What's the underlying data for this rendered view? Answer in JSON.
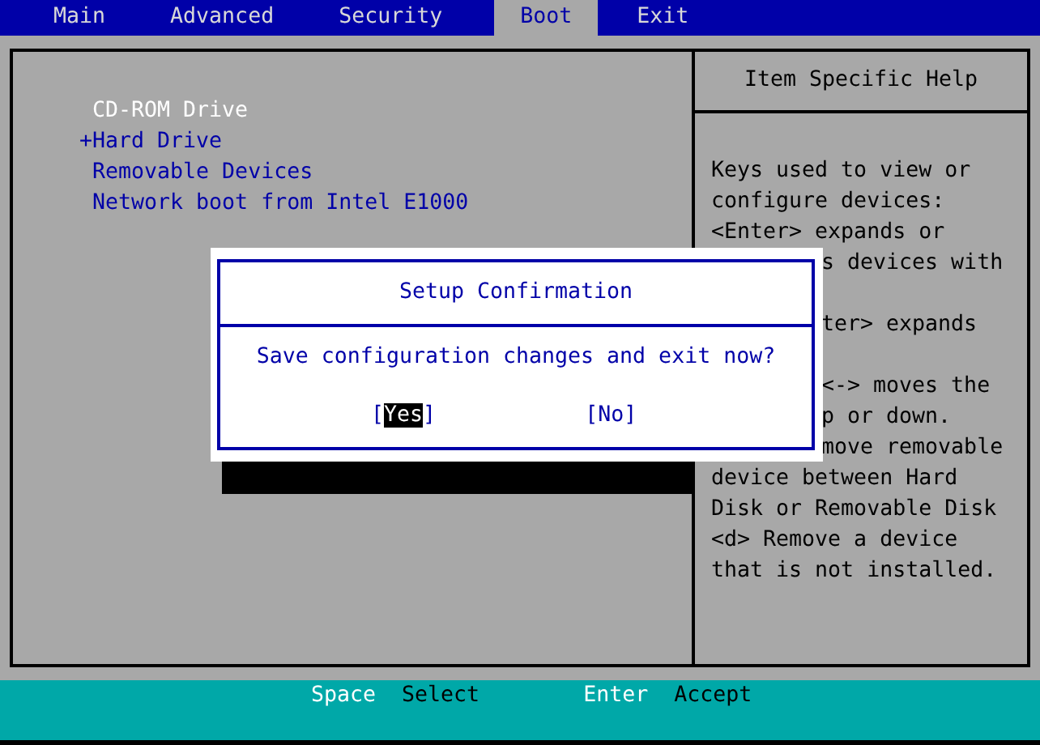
{
  "menu": [
    {
      "label": "Main",
      "selected": false
    },
    {
      "label": "Advanced",
      "selected": false
    },
    {
      "label": "Security",
      "selected": false
    },
    {
      "label": "Boot",
      "selected": true
    },
    {
      "label": "Exit",
      "selected": false
    }
  ],
  "boot_items": [
    {
      "label": "CD-ROM Drive",
      "kind": "device",
      "selected": true
    },
    {
      "label": "+Hard Drive",
      "kind": "expandable",
      "selected": false
    },
    {
      "label": "Removable Devices",
      "kind": "device",
      "selected": false
    },
    {
      "label": "Network boot from Intel E1000",
      "kind": "device",
      "selected": false
    }
  ],
  "help": {
    "title": "Item Specific Help",
    "lines": [
      {
        "text": "Keys used to view or",
        "kind": "full"
      },
      {
        "text": "configure devices:",
        "kind": "full"
      },
      {
        "text": "<Enter> expands or",
        "kind": "full"
      },
      {
        "text": "s devices with",
        "kind": "partial"
      },
      {
        "kind": "gap"
      },
      {
        "text": "ter> expands",
        "kind": "partial"
      },
      {
        "kind": "gap"
      },
      {
        "text": "<-> moves the",
        "kind": "partial"
      },
      {
        "text": "p or down.",
        "kind": "partial"
      },
      {
        "text": "move removable",
        "kind": "partial"
      },
      {
        "text": "device between Hard",
        "kind": "full"
      },
      {
        "text": "Disk or Removable Disk",
        "kind": "full"
      },
      {
        "text": "<d> Remove a device",
        "kind": "full"
      },
      {
        "text": "that is not installed.",
        "kind": "full"
      }
    ]
  },
  "dialog": {
    "title": "Setup Confirmation",
    "message": "Save configuration changes and exit now?",
    "buttons": [
      {
        "open": "[",
        "label": "Yes",
        "close": "]",
        "selected": true
      },
      {
        "open": "[",
        "label": "No",
        "close": "]",
        "selected": false
      }
    ]
  },
  "status_bar": [
    {
      "key": "Space",
      "action": "Select"
    },
    {
      "key": "Enter",
      "action": "Accept"
    }
  ]
}
